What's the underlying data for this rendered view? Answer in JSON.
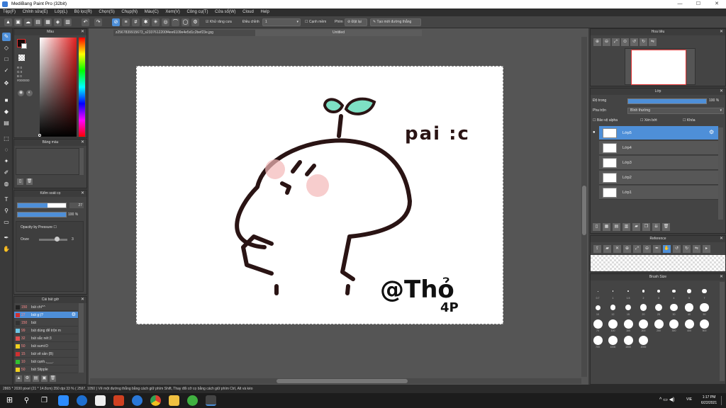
{
  "window": {
    "title": "MediBang Paint Pro (32bit)",
    "controls": {
      "minimize": "—",
      "maximize": "☐",
      "close": "✕"
    }
  },
  "menu": [
    "Tệp(F)",
    "Chỉnh sửa(E)",
    "Lớp(L)",
    "Bộ lọc(R)",
    "Chọn(S)",
    "Chụp(N)",
    "Màu(C)",
    "Xem(V)",
    "Công cụ(T)",
    "Cửa sổ(W)",
    "Cloud",
    "Help"
  ],
  "toolbar": {
    "anti_alias_label": "Khử răng cưa",
    "correction_label": "Điều chỉnh",
    "correction_value": "1",
    "canh_mem_label": "Cạnh mềm",
    "phim_label": "Phím",
    "dat_lai_label": "Đặt lại",
    "line_label": "Tạo mới đường thẳng"
  },
  "tabs": {
    "file": "z2567839915673_s2337612200f4ee6109e4e5d1c2bef23e.jpg",
    "untitled": "Untitled"
  },
  "color_panel": {
    "title": "Màu",
    "r": "R 0",
    "g": "G 0",
    "b": "B 0",
    "hex": "#000000",
    "primary": "#1a0a0a",
    "secondary": "#ffffff",
    "accent": "#e03030"
  },
  "color_set_panel": {
    "title": "Bảng màu"
  },
  "brush_control": {
    "title": "Kiểm soát cọ",
    "size_value": "27",
    "size_fill": 0.62,
    "opacity_value": "100 %",
    "opacity_fill": 1.0,
    "opacity_by_pressure_label": "Opacity by Pressure",
    "ooze_label": "Ooze",
    "ooze_value": "3"
  },
  "brushes": {
    "title": "Cài bút giờ",
    "items": [
      {
        "size": "150",
        "name": "bút chì^^",
        "color": "#222222"
      },
      {
        "size": "27",
        "name": "bút g:)?",
        "color": "#d03030",
        "selected": true
      },
      {
        "size": "150",
        "name": "bút",
        "color": "#333333"
      },
      {
        "size": "99",
        "name": "bút dùng để trộn m",
        "color": "#6ec6e6"
      },
      {
        "size": "32",
        "name": "bút sắc nét:3",
        "color": "#e05050"
      },
      {
        "size": "50",
        "name": "bút sumi:D",
        "color": "#f0d020"
      },
      {
        "size": "15",
        "name": "bút vẽ sần (B)",
        "color": "#d03030"
      },
      {
        "size": "10",
        "name": "bút cạnh.,___.",
        "color": "#30c030"
      },
      {
        "size": "50",
        "name": "bút Stipple",
        "color": "#f0d020"
      }
    ]
  },
  "navigator": {
    "title": "Hoa tiêu"
  },
  "layer_panel": {
    "title": "Lớp",
    "opacity_label": "Độ trong",
    "opacity_value": "100 %",
    "blend_label": "Pha trộn",
    "blend_value": "Bình thường",
    "protect_alpha": "Bảo vệ alpha",
    "clipping": "Xén bớt",
    "lock": "Khóa",
    "layers": [
      {
        "name": "Lớp5",
        "selected": true
      },
      {
        "name": "Lớp4"
      },
      {
        "name": "Lớp3"
      },
      {
        "name": "Lớp2"
      },
      {
        "name": "Lớp1"
      }
    ]
  },
  "reference_panel": {
    "title": "Reference"
  },
  "brush_size_panel": {
    "title": "Brush Size",
    "sizes": [
      "0.7",
      "1",
      "1.5",
      "2",
      "3",
      "4",
      "5",
      "7",
      "10",
      "12",
      "15",
      "20",
      "25",
      "30",
      "40",
      "50",
      "70",
      "100",
      "150",
      "200",
      "250",
      "300",
      "400",
      "500",
      "700",
      "1000",
      "1500",
      "2000"
    ]
  },
  "status": {
    "text": "2865 * 2030 pixel  (21 * 14.8cm)  350 dpi  33 %  ( 2597, 1050 )  Vẽ một đường thẳng bằng cách giữ phím Shift, Thay đổi cỡ cọ bằng cách giữ phím Ctrl, Alt và kéo"
  },
  "drawing": {
    "text_right": "pai :c",
    "signature": "@Thỏ",
    "signature_sub": "4P"
  },
  "taskbar": {
    "time": "1:17 PM",
    "date": "6/22/2021",
    "lang": "VIE"
  }
}
